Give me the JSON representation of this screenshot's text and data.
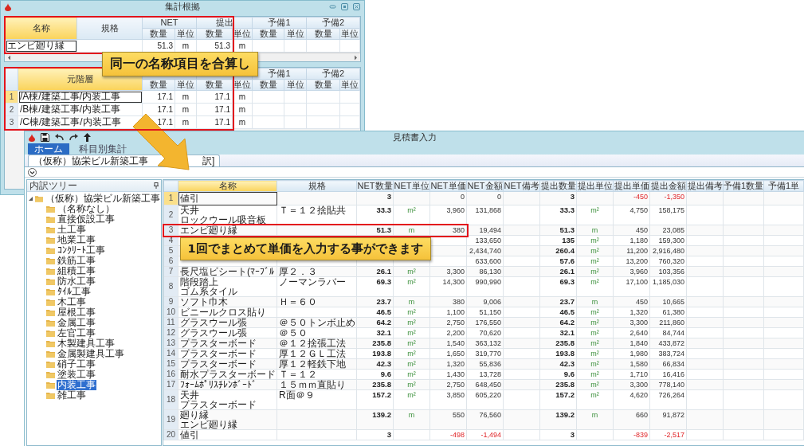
{
  "summary_window": {
    "title": "集計根拠",
    "top_grid": {
      "columns": [
        {
          "label": "名称",
          "selected": true
        },
        {
          "label": "規格",
          "selected": false
        }
      ],
      "groups": [
        "NET",
        "提出",
        "予備1",
        "予備2"
      ],
      "subcolumns": [
        "数量",
        "単位",
        "数量",
        "単位",
        "数量",
        "単位",
        "数量",
        "単位"
      ],
      "rows": [
        {
          "name": "エンビ廻り縁",
          "net_qty": "51.3",
          "net_unit": "m",
          "sub_qty": "51.3",
          "sub_unit": "m",
          "selected": true
        }
      ]
    },
    "lower_grid": {
      "columns": [
        {
          "label": "元階層",
          "selected": true
        }
      ],
      "groups": [
        "予備1",
        "予備2"
      ],
      "subcolumns": [
        "数量",
        "単位",
        "数量",
        "単位",
        "数量",
        "単位",
        "数量",
        "単位"
      ],
      "rows": [
        {
          "number": "1",
          "name": "/A棟/建築工事/内装工事",
          "net_qty": "17.1",
          "net_unit": "m",
          "sub_qty": "17.1",
          "sub_unit": "m",
          "selected": true
        },
        {
          "number": "2",
          "name": "/B棟/建築工事/内装工事",
          "net_qty": "17.1",
          "net_unit": "m",
          "sub_qty": "17.1",
          "sub_unit": "m",
          "selected": false
        },
        {
          "number": "3",
          "name": "/C棟/建築工事/内装工事",
          "net_qty": "17.1",
          "net_unit": "m",
          "sub_qty": "17.1",
          "sub_unit": "m",
          "selected": false
        }
      ]
    }
  },
  "estimate_window": {
    "title": "見積書入力",
    "ribbon_tabs": [
      {
        "label": "ホーム",
        "selected": true
      },
      {
        "label": "科目別集計",
        "selected": false
      }
    ],
    "document_tab": {
      "label": "（仮称）協栄ビル新築工事",
      "tail": "訳]"
    },
    "tree": {
      "title": "内訳ツリー",
      "items": [
        {
          "label": "（仮称）協栄ビル新築工事",
          "expanded": true,
          "selected": false,
          "children": [
            {
              "label": "（名称なし）",
              "selected": false
            },
            {
              "label": "直接仮設工事",
              "selected": false
            },
            {
              "label": "土工事",
              "selected": false
            },
            {
              "label": "地業工事",
              "selected": false
            },
            {
              "label": "ｺﾝｸﾘｰﾄ工事",
              "selected": false
            },
            {
              "label": "鉄筋工事",
              "selected": false
            },
            {
              "label": "組積工事",
              "selected": false
            },
            {
              "label": "防水工事",
              "selected": false
            },
            {
              "label": "ﾀｲﾙ工事",
              "selected": false
            },
            {
              "label": "木工事",
              "selected": false
            },
            {
              "label": "屋根工事",
              "selected": false
            },
            {
              "label": "金属工事",
              "selected": false
            },
            {
              "label": "左官工事",
              "selected": false
            },
            {
              "label": "木製建具工事",
              "selected": false
            },
            {
              "label": "金属製建具工事",
              "selected": false
            },
            {
              "label": "硝子工事",
              "selected": false
            },
            {
              "label": "塗装工事",
              "selected": false
            },
            {
              "label": "内装工事",
              "selected": true
            },
            {
              "label": "雑工事",
              "selected": false
            }
          ]
        }
      ]
    },
    "table": {
      "columns": [
        {
          "label": "名称",
          "selected": true
        },
        {
          "label": "規格",
          "selected": false
        },
        {
          "label": "NET数量",
          "selected": false
        },
        {
          "label": "NET単位",
          "selected": false
        },
        {
          "label": "NET単価",
          "selected": false
        },
        {
          "label": "NET金額",
          "selected": false
        },
        {
          "label": "NET備考",
          "selected": false
        },
        {
          "label": "提出数量",
          "selected": false
        },
        {
          "label": "提出単位",
          "selected": false
        },
        {
          "label": "提出単価",
          "selected": false
        },
        {
          "label": "提出金額",
          "selected": false
        },
        {
          "label": "提出備考",
          "selected": false
        },
        {
          "label": "予備1数量",
          "selected": false
        },
        {
          "label": "予備1単",
          "selected": false
        }
      ],
      "rows": [
        {
          "number": "1",
          "selected": true,
          "name": "値引",
          "net_qty": "3",
          "net_price": "0",
          "net_amount": "0",
          "sub_qty": "3",
          "sub_price": "-450",
          "sub_amount": "-1,350",
          "net_negative": false,
          "sub_negative": true
        },
        {
          "number": "2",
          "selected": false,
          "name": [
            "天井",
            "ロックウール吸音板"
          ],
          "spec": "Ｔ＝１２捨貼共",
          "net_qty": "33.3",
          "net_unit": "m²",
          "net_price": "3,960",
          "net_amount": "131,868",
          "sub_qty": "33.3",
          "sub_unit": "m²",
          "sub_price": "4,750",
          "sub_amount": "158,175",
          "net_negative": false,
          "sub_negative": false
        },
        {
          "number": "3",
          "selected": false,
          "name": "エンビ廻り縁",
          "net_qty": "51.3",
          "net_unit": "m",
          "net_price": "380",
          "net_amount": "19,494",
          "sub_qty": "51.3",
          "sub_unit": "m",
          "sub_price": "450",
          "sub_amount": "23,085",
          "net_negative": false,
          "sub_negative": false
        },
        {
          "number": "4",
          "selected": false,
          "net_amount": "133,650",
          "sub_qty": "135",
          "sub_unit": "m²",
          "sub_price": "1,180",
          "sub_amount": "159,300",
          "net_negative": false,
          "sub_negative": false
        },
        {
          "number": "5",
          "selected": false,
          "net_amount": "2,434,740",
          "sub_qty": "260.4",
          "sub_unit": "m²",
          "sub_price": "11,200",
          "sub_amount": "2,916,480",
          "net_negative": false,
          "sub_negative": false
        },
        {
          "number": "6",
          "selected": false,
          "net_amount": "633,600",
          "sub_qty": "57.6",
          "sub_unit": "m²",
          "sub_price": "13,200",
          "sub_amount": "760,320",
          "net_negative": false,
          "sub_negative": false
        },
        {
          "number": "7",
          "selected": false,
          "name": "長尺塩ビシート(ﾏｰﾌﾞﾙ",
          "spec": "厚２．３",
          "net_qty": "26.1",
          "net_unit": "m²",
          "net_price": "3,300",
          "net_amount": "86,130",
          "sub_qty": "26.1",
          "sub_unit": "m²",
          "sub_price": "3,960",
          "sub_amount": "103,356",
          "net_negative": false,
          "sub_negative": false
        },
        {
          "number": "8",
          "selected": false,
          "name": [
            "階段踏上",
            "ゴム系タイル"
          ],
          "spec": "ノーマンラバー",
          "net_qty": "69.3",
          "net_unit": "m²",
          "net_price": "14,300",
          "net_amount": "990,990",
          "sub_qty": "69.3",
          "sub_unit": "m²",
          "sub_price": "17,100",
          "sub_amount": "1,185,030",
          "net_negative": false,
          "sub_negative": false
        },
        {
          "number": "9",
          "selected": false,
          "name": "ソフト巾木",
          "spec": "Ｈ＝６０",
          "net_qty": "23.7",
          "net_unit": "m",
          "net_price": "380",
          "net_amount": "9,006",
          "sub_qty": "23.7",
          "sub_unit": "m",
          "sub_price": "450",
          "sub_amount": "10,665",
          "net_negative": false,
          "sub_negative": false
        },
        {
          "number": "10",
          "selected": false,
          "name": "ビニールクロス貼り",
          "net_qty": "46.5",
          "net_unit": "m²",
          "net_price": "1,100",
          "net_amount": "51,150",
          "sub_qty": "46.5",
          "sub_unit": "m²",
          "sub_price": "1,320",
          "sub_amount": "61,380",
          "net_negative": false,
          "sub_negative": false
        },
        {
          "number": "11",
          "selected": false,
          "name": "グラスウール張",
          "spec": "＠５０トンボ止め",
          "net_qty": "64.2",
          "net_unit": "m²",
          "net_price": "2,750",
          "net_amount": "176,550",
          "sub_qty": "64.2",
          "sub_unit": "m²",
          "sub_price": "3,300",
          "sub_amount": "211,860",
          "net_negative": false,
          "sub_negative": false
        },
        {
          "number": "12",
          "selected": false,
          "name": "グラスウール張",
          "spec": "＠５０",
          "net_qty": "32.1",
          "net_unit": "m²",
          "net_price": "2,200",
          "net_amount": "70,620",
          "sub_qty": "32.1",
          "sub_unit": "m²",
          "sub_price": "2,640",
          "sub_amount": "84,744",
          "net_negative": false,
          "sub_negative": false
        },
        {
          "number": "13",
          "selected": false,
          "name": "プラスターボード",
          "spec": "＠１２捨張工法",
          "net_qty": "235.8",
          "net_unit": "m²",
          "net_price": "1,540",
          "net_amount": "363,132",
          "sub_qty": "235.8",
          "sub_unit": "m²",
          "sub_price": "1,840",
          "sub_amount": "433,872",
          "net_negative": false,
          "sub_negative": false
        },
        {
          "number": "14",
          "selected": false,
          "name": "プラスターボード",
          "spec": "厚１２ＧＬ工法",
          "net_qty": "193.8",
          "net_unit": "m²",
          "net_price": "1,650",
          "net_amount": "319,770",
          "sub_qty": "193.8",
          "sub_unit": "m²",
          "sub_price": "1,980",
          "sub_amount": "383,724",
          "net_negative": false,
          "sub_negative": false
        },
        {
          "number": "15",
          "selected": false,
          "name": "プラスターボード",
          "spec": "厚１２軽鉄下地",
          "net_qty": "42.3",
          "net_unit": "m²",
          "net_price": "1,320",
          "net_amount": "55,836",
          "sub_qty": "42.3",
          "sub_unit": "m²",
          "sub_price": "1,580",
          "sub_amount": "66,834",
          "net_negative": false,
          "sub_negative": false
        },
        {
          "number": "16",
          "selected": false,
          "name": "耐水プラスターボード",
          "spec": "Ｔ＝１２",
          "net_qty": "9.6",
          "net_unit": "m²",
          "net_price": "1,430",
          "net_amount": "13,728",
          "sub_qty": "9.6",
          "sub_unit": "m²",
          "sub_price": "1,710",
          "sub_amount": "16,416",
          "net_negative": false,
          "sub_negative": false
        },
        {
          "number": "17",
          "selected": false,
          "name": "ﾌｫｰﾑﾎﾟﾘｽﾁﾚﾝﾎﾞｰﾄﾞ",
          "spec": "１５ｍｍ直貼り",
          "net_qty": "235.8",
          "net_unit": "m²",
          "net_price": "2,750",
          "net_amount": "648,450",
          "sub_qty": "235.8",
          "sub_unit": "m²",
          "sub_price": "3,300",
          "sub_amount": "778,140",
          "net_negative": false,
          "sub_negative": false
        },
        {
          "number": "18",
          "selected": false,
          "name": [
            "天井",
            "プラスターボード"
          ],
          "spec": "R面＠９",
          "net_qty": "157.2",
          "net_unit": "m²",
          "net_price": "3,850",
          "net_amount": "605,220",
          "sub_qty": "157.2",
          "sub_unit": "m²",
          "sub_price": "4,620",
          "sub_amount": "726,264",
          "net_negative": false,
          "sub_negative": false
        },
        {
          "number": "19",
          "selected": false,
          "name": [
            "廻り縁",
            "エンビ廻り縁"
          ],
          "net_qty": "139.2",
          "net_unit": "m",
          "net_price": "550",
          "net_amount": "76,560",
          "sub_qty": "139.2",
          "sub_unit": "m",
          "sub_price": "660",
          "sub_amount": "91,872",
          "net_negative": false,
          "sub_negative": false
        },
        {
          "number": "20",
          "selected": false,
          "name": "値引",
          "net_qty": "3",
          "net_price": "-498",
          "net_amount": "-1,494",
          "sub_qty": "3",
          "sub_price": "-839",
          "sub_amount": "-2,517",
          "net_negative": true,
          "sub_negative": true
        }
      ]
    }
  },
  "callouts": [
    "同一の名称項目を合算し",
    "1回でまとめて単価を入力する事ができます"
  ]
}
